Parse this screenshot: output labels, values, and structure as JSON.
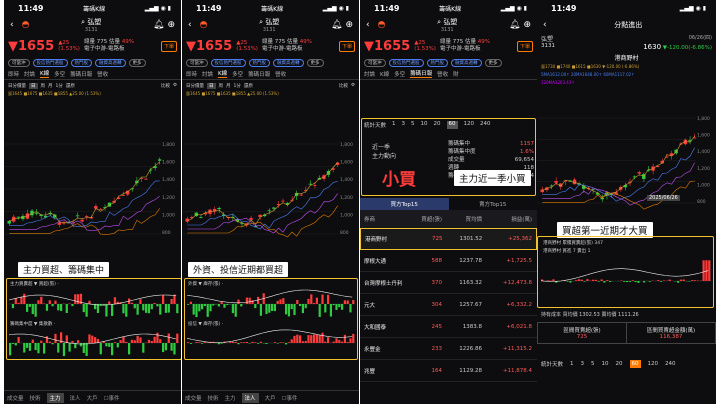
{
  "status": {
    "time": "11:49",
    "signal": "4G",
    "battery": "80",
    "app": "籌碼K線"
  },
  "stock": {
    "name": "弘塑",
    "code": "3131",
    "price": "1655",
    "change": "▲25",
    "change_pct": "(1.53%)",
    "volume_label": "總量",
    "volume": "775",
    "est_label": "估量",
    "est": "49%",
    "sector": "電子中游-電路板",
    "badge": "下單",
    "flag": "短線",
    "alert": "可當沖",
    "top_tag": "投信熱門選股",
    "hot_tag": "熱門股",
    "heat_tag": "融資高週轉",
    "more": "更多"
  },
  "tabs": [
    "即時",
    "討論",
    "K線",
    "多空",
    "籌碼日報",
    "營收",
    "財"
  ],
  "ktool": [
    "日分價量",
    "日",
    "周",
    "月",
    "1分",
    "還原",
    "比較"
  ],
  "ma_line": "量1645 ■1675 ■1635 ■1855 ▲25.00 (1.53%)",
  "panel_a": {
    "caption": "主力買超、籌碼集中",
    "sub1": "主力買賣超 ▼ 買超(張) ·",
    "sub2": "籌碼集中度 ▼ 集散數 ·"
  },
  "panel_b": {
    "caption": "外資、投信近期都買超",
    "sub1": "外資 ▼ 庫存(張) ·",
    "sub2": "投信 ▼ 庫存(張) ·"
  },
  "bottom_tabs": [
    "成交量",
    "技術",
    "主力",
    "法人",
    "大戶",
    "事件",
    "首標線"
  ],
  "panel_c": {
    "title_label": "統計天數",
    "ranges": [
      "1",
      "3",
      "5",
      "10",
      "20",
      "60",
      "120",
      "240"
    ],
    "active_range": "60",
    "box_left_top": "近一季",
    "box_left_mid": "主力動向",
    "big_word": "小買",
    "caption": "主力近一季小買",
    "stat1_label": "籌碼集中",
    "stat1_val": "1157",
    "stat2_label": "籌碼集中度",
    "stat2_val": "1.6%",
    "stat3_label": "成交量",
    "stat3_val": "69,654",
    "stat4_label": "週轉",
    "stat4_val": "118",
    "stat5_label": "籌碼週轉率",
    "stat5_val": "238.54",
    "tab_buy": "買方Top15",
    "tab_sell": "賣方Top15",
    "col1": "券商",
    "col2": "買超(張)",
    "col3": "買均價",
    "col4": "損益(萬)",
    "rows": [
      {
        "name": "港商野村",
        "buy": "725",
        "avg": "1301.52",
        "pnl": "+25,362"
      },
      {
        "name": "摩根大通",
        "buy": "588",
        "avg": "1237.78",
        "pnl": "+1,725.5"
      },
      {
        "name": "台灣摩根士丹利",
        "buy": "370",
        "avg": "1163.32",
        "pnl": "+12,473.8"
      },
      {
        "name": "元大",
        "buy": "304",
        "avg": "1257.67",
        "pnl": "+6,332.2"
      },
      {
        "name": "大和國泰",
        "buy": "245",
        "avg": "1383.8",
        "pnl": "+6,021.8"
      },
      {
        "name": "永豐金",
        "buy": "233",
        "avg": "1226.86",
        "pnl": "+11,315.2"
      },
      {
        "name": "兆豐",
        "buy": "164",
        "avg": "1129.28",
        "pnl": "+11,878.4"
      }
    ]
  },
  "panel_d": {
    "header": "分點進出",
    "date": "06/26(四)",
    "price": "1630",
    "chg": "▼-120.00(-6.86%)",
    "broker": "港商野村",
    "ma_line": "量1730 ■1740 ■1615 ■1630 ▼-120.00 (-6.86%)",
    "ma2": "5MA1612.00↑ 20MA1648.00↑ 60MA1117.02↑",
    "ma3": "120MA1203.43↑",
    "y_label_top": "1630",
    "date_tag": "2025/06/26",
    "caption": "買超第一近期才大買",
    "sub1": "港商野村 累積買賣超(張) 347",
    "sub2": "港商野村 買進 7 賣出 1",
    "bottom_info": "持有成本 買均價 1302.53 賣均價 1111.26",
    "cost_label": "區間買賣超(張)",
    "cost_val": "725",
    "amt_label": "區間買賣超金額(萬)",
    "amt_val": "116,387",
    "range_label": "統計天數",
    "ranges": [
      "1",
      "3",
      "5",
      "10",
      "20",
      "60",
      "120",
      "240"
    ],
    "active_range": "60"
  },
  "y_ticks": [
    "1,800",
    "1,600",
    "1,400",
    "1,200",
    "1,000",
    "800"
  ],
  "colors": {
    "up": "#ff3b3b",
    "down": "#2ecc40",
    "highlight": "#f2c12e",
    "accent": "#ff7a00"
  }
}
